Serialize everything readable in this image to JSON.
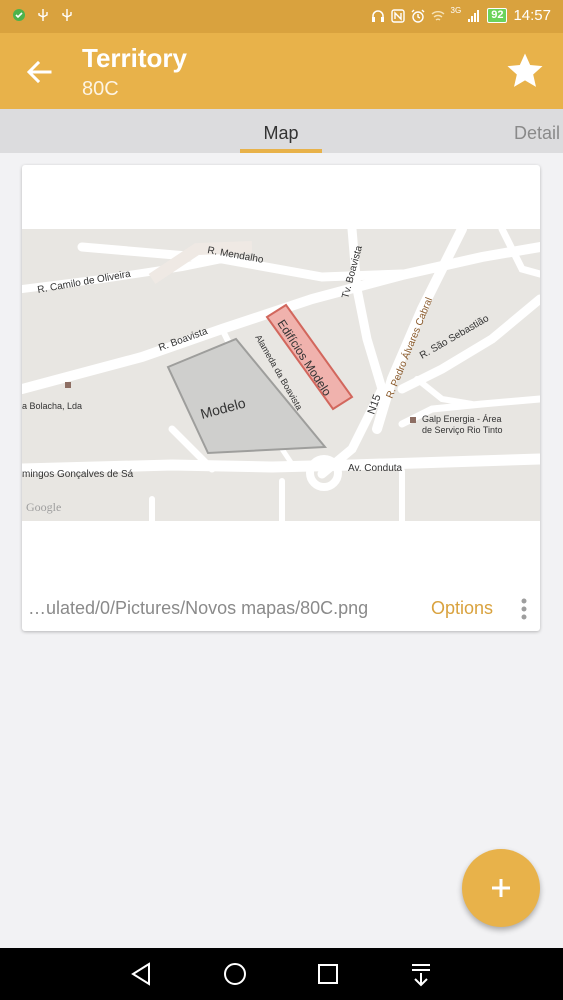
{
  "status_bar": {
    "time": "14:57",
    "battery": "92",
    "network": "3G",
    "icons": [
      "app-notification-icon",
      "usb-icon",
      "usb-icon",
      "headset-icon",
      "nfc-icon",
      "alarm-icon",
      "wifi-icon",
      "signal-icon",
      "battery-icon"
    ]
  },
  "app_bar": {
    "title": "Territory",
    "subtitle": "80C",
    "back_icon": "arrow-back-icon",
    "favorite_icon": "star-icon"
  },
  "tabs": [
    {
      "label": "Map",
      "selected": true
    },
    {
      "label": "Detail",
      "selected": false
    }
  ],
  "card": {
    "map_labels": {
      "r_mendalho": "R. Mendalho",
      "r_camilo": "R. Camilo de Oliveira",
      "r_boavista": "R. Boavista",
      "tv_boavista": "Tv. Boavista",
      "edificios_modelo": "Edifícios Modelo",
      "alameda": "Alameda da Boavista",
      "modelo": "Modelo",
      "bolacha": "a Bolacha, Lda",
      "r_pedro": "R. Pedro Álvares Cabral",
      "r_sao_sebastiao": "R. São Sebastião",
      "n15": "N15",
      "galp1": "Galp Energia - Área",
      "galp2": "de Serviço Rio Tinto",
      "domingos": "mingos Gonçalves de Sá",
      "av_condutas": "Av. Conduta",
      "google": "Google"
    },
    "file_path": "…ulated/0/Pictures/Novos mapas/80C.png",
    "options_label": "Options",
    "more_icon": "more-vert-icon"
  },
  "fab": {
    "icon": "plus-icon"
  },
  "nav_bar": {
    "icons": [
      "back-triangle-icon",
      "home-circle-icon",
      "recents-square-icon",
      "notification-pull-icon"
    ]
  },
  "colors": {
    "accent": "#e8b24a",
    "status_bar": "#d9a23e",
    "tab_bar": "#dcdcde",
    "background": "#f2f2f4",
    "map_land": "#e8e6e2",
    "map_building": "#cfcfcd",
    "map_highlight": "#f0b2ad"
  }
}
